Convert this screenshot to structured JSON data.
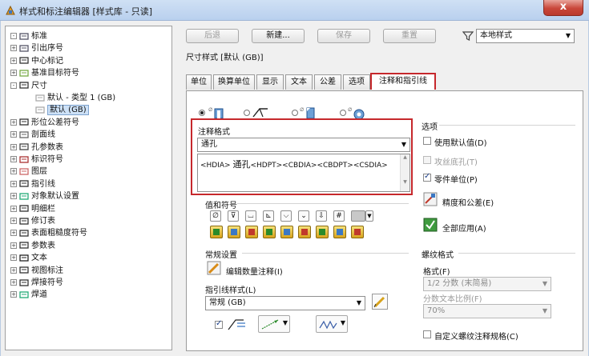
{
  "window": {
    "title": "样式和标注编辑器 [样式库 - 只读]",
    "close_glyph": "x"
  },
  "toolbar": {
    "back_label": "后退",
    "new_label": "新建...",
    "save_label": "保存",
    "reset_label": "重置",
    "filter_value": "本地样式"
  },
  "style_title": "尺寸样式 [默认 (GB)]",
  "tabs": [
    "单位",
    "换算单位",
    "显示",
    "文本",
    "公差",
    "选项",
    "注释和指引线"
  ],
  "tree": {
    "items": [
      {
        "label": "标准",
        "expander": "-"
      },
      {
        "label": "引出序号",
        "expander": "+"
      },
      {
        "label": "中心标记",
        "expander": "+"
      },
      {
        "label": "基准目标符号",
        "expander": "+"
      },
      {
        "label": "尺寸",
        "expander": "-"
      },
      {
        "label": "默认 - 类型 1 (GB)",
        "expander": ""
      },
      {
        "label": "默认 (GB)",
        "expander": ""
      },
      {
        "label": "形位公差符号",
        "expander": "+"
      },
      {
        "label": "剖面线",
        "expander": "+"
      },
      {
        "label": "孔参数表",
        "expander": "+"
      },
      {
        "label": "标识符号",
        "expander": "+"
      },
      {
        "label": "图层",
        "expander": "+"
      },
      {
        "label": "指引线",
        "expander": "+"
      },
      {
        "label": "对象默认设置",
        "expander": "+"
      },
      {
        "label": "明细栏",
        "expander": "+"
      },
      {
        "label": "修订表",
        "expander": "+"
      },
      {
        "label": "表面粗糙度符号",
        "expander": "+"
      },
      {
        "label": "参数表",
        "expander": "+"
      },
      {
        "label": "文本",
        "expander": "+"
      },
      {
        "label": "视图标注",
        "expander": "+"
      },
      {
        "label": "焊接符号",
        "expander": "+"
      },
      {
        "label": "焊道",
        "expander": "+"
      }
    ]
  },
  "note_format": {
    "label": "注释格式",
    "type_value": "通孔",
    "text_hdia": "<HDIA>",
    "text_through": "通孔",
    "text_rest": "<HDPT><CBDIA><CBDPT><CSDIA>"
  },
  "insert_symbol_label": "值和符号",
  "options": {
    "label": "选项",
    "use_default": "使用默认值(D)",
    "counterbore": "攻丝底孔(T)",
    "part_units": "零件单位(P)",
    "precision_btn": "精度和公差(E)",
    "apply_all_btn": "全部应用(A)"
  },
  "general": {
    "label": "常规设置",
    "edit_note_btn": "编辑数量注释(I)",
    "leader_style_label": "指引线样式(L)",
    "leader_style_value": "常规 (GB)"
  },
  "thread": {
    "label": "螺纹格式",
    "format_label": "格式(F)",
    "format_value": "1/2 分数 (末简易)",
    "fraction_label": "分数文本比例(F)",
    "fraction_value": "70%",
    "custom_label": "自定义螺纹注释规格(C)"
  },
  "colors": {
    "accent_red": "#c6282c",
    "selection": "#cde1f7"
  }
}
